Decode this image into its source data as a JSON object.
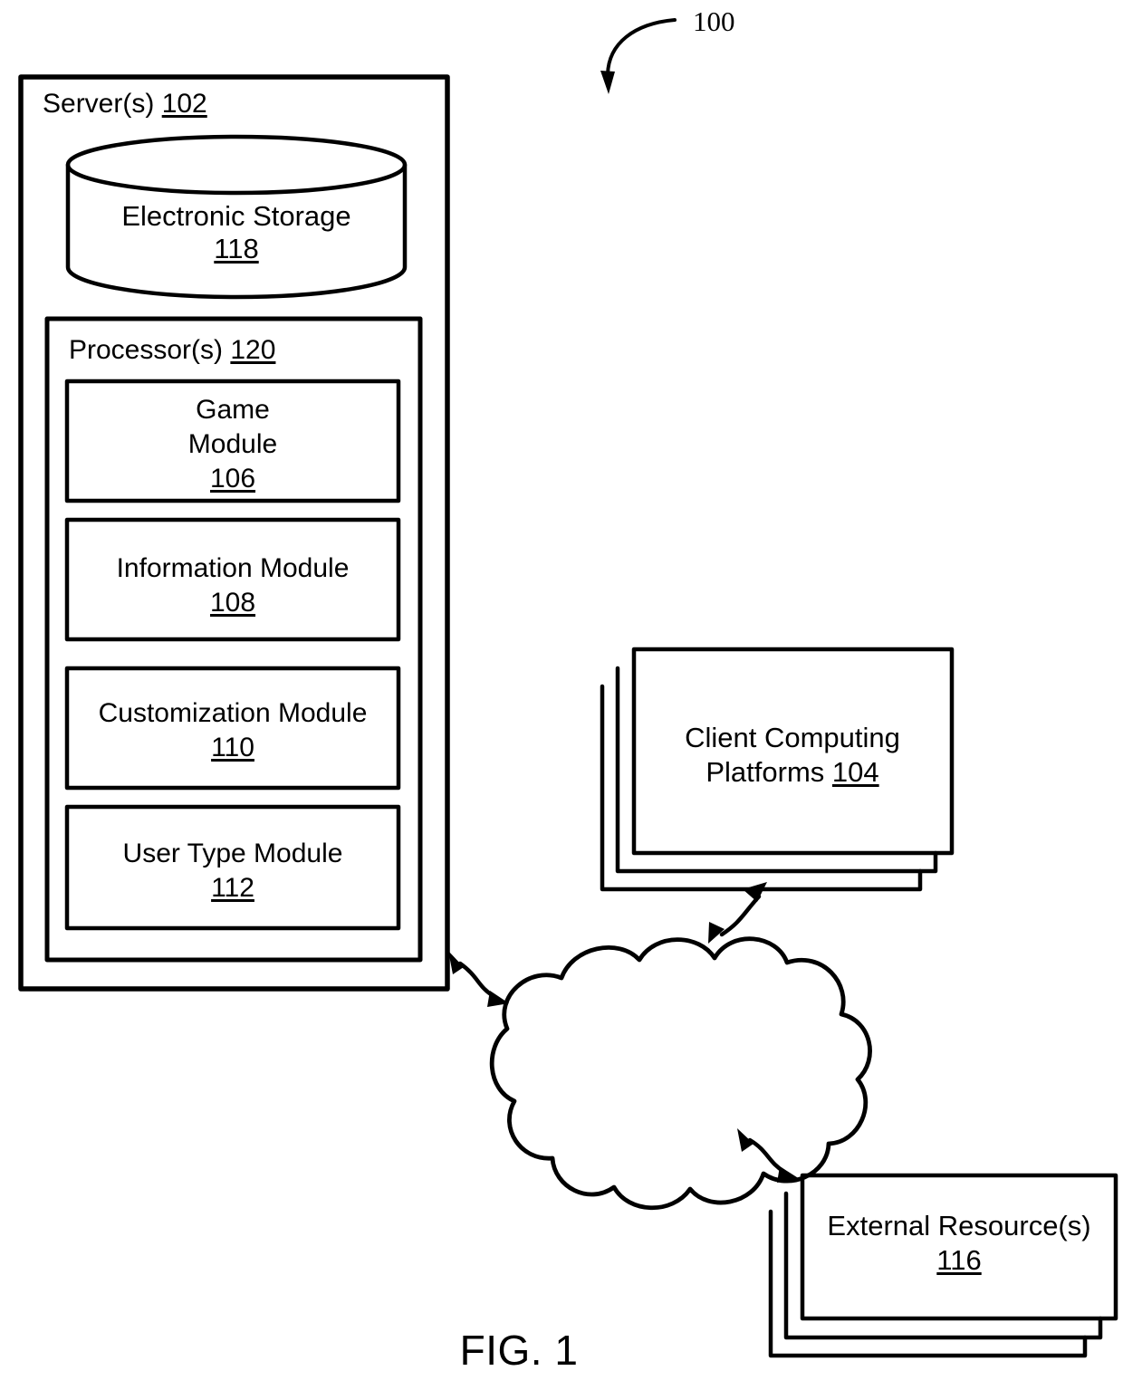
{
  "figure": {
    "reference_numeral": "100",
    "caption": "FIG. 1",
    "stroke_color": "#000000",
    "background_color": "#ffffff"
  },
  "server_box": {
    "title_text": "Server(s)",
    "title_ref": "102",
    "storage": {
      "label": "Electronic Storage",
      "ref": "118",
      "shape": "cylinder"
    },
    "processor_box": {
      "title_text": "Processor(s)",
      "title_ref": "120",
      "modules": [
        {
          "name": "game-module",
          "line1": "Game",
          "line2": "Module",
          "ref": "106"
        },
        {
          "name": "information-module",
          "line1": "Information Module",
          "line2": "",
          "ref": "108"
        },
        {
          "name": "customization-module",
          "line1": "Customization Module",
          "line2": "",
          "ref": "110"
        },
        {
          "name": "user-type-module",
          "line1": "User Type Module",
          "line2": "",
          "ref": "112"
        }
      ]
    }
  },
  "client_platforms": {
    "line1": "Client Computing",
    "line2": "Platforms",
    "ref": "104",
    "stack_count": 3
  },
  "external_resources": {
    "line1": "External Resource(s)",
    "ref": "116",
    "stack_count": 3
  },
  "network": {
    "shape": "cloud",
    "label": ""
  },
  "connectors": [
    {
      "name": "server-to-cloud",
      "type": "bidirectional-curved-arrow"
    },
    {
      "name": "cloud-to-client-platforms",
      "type": "bidirectional-curved-arrow"
    },
    {
      "name": "cloud-to-external-resources",
      "type": "bidirectional-curved-arrow"
    }
  ]
}
